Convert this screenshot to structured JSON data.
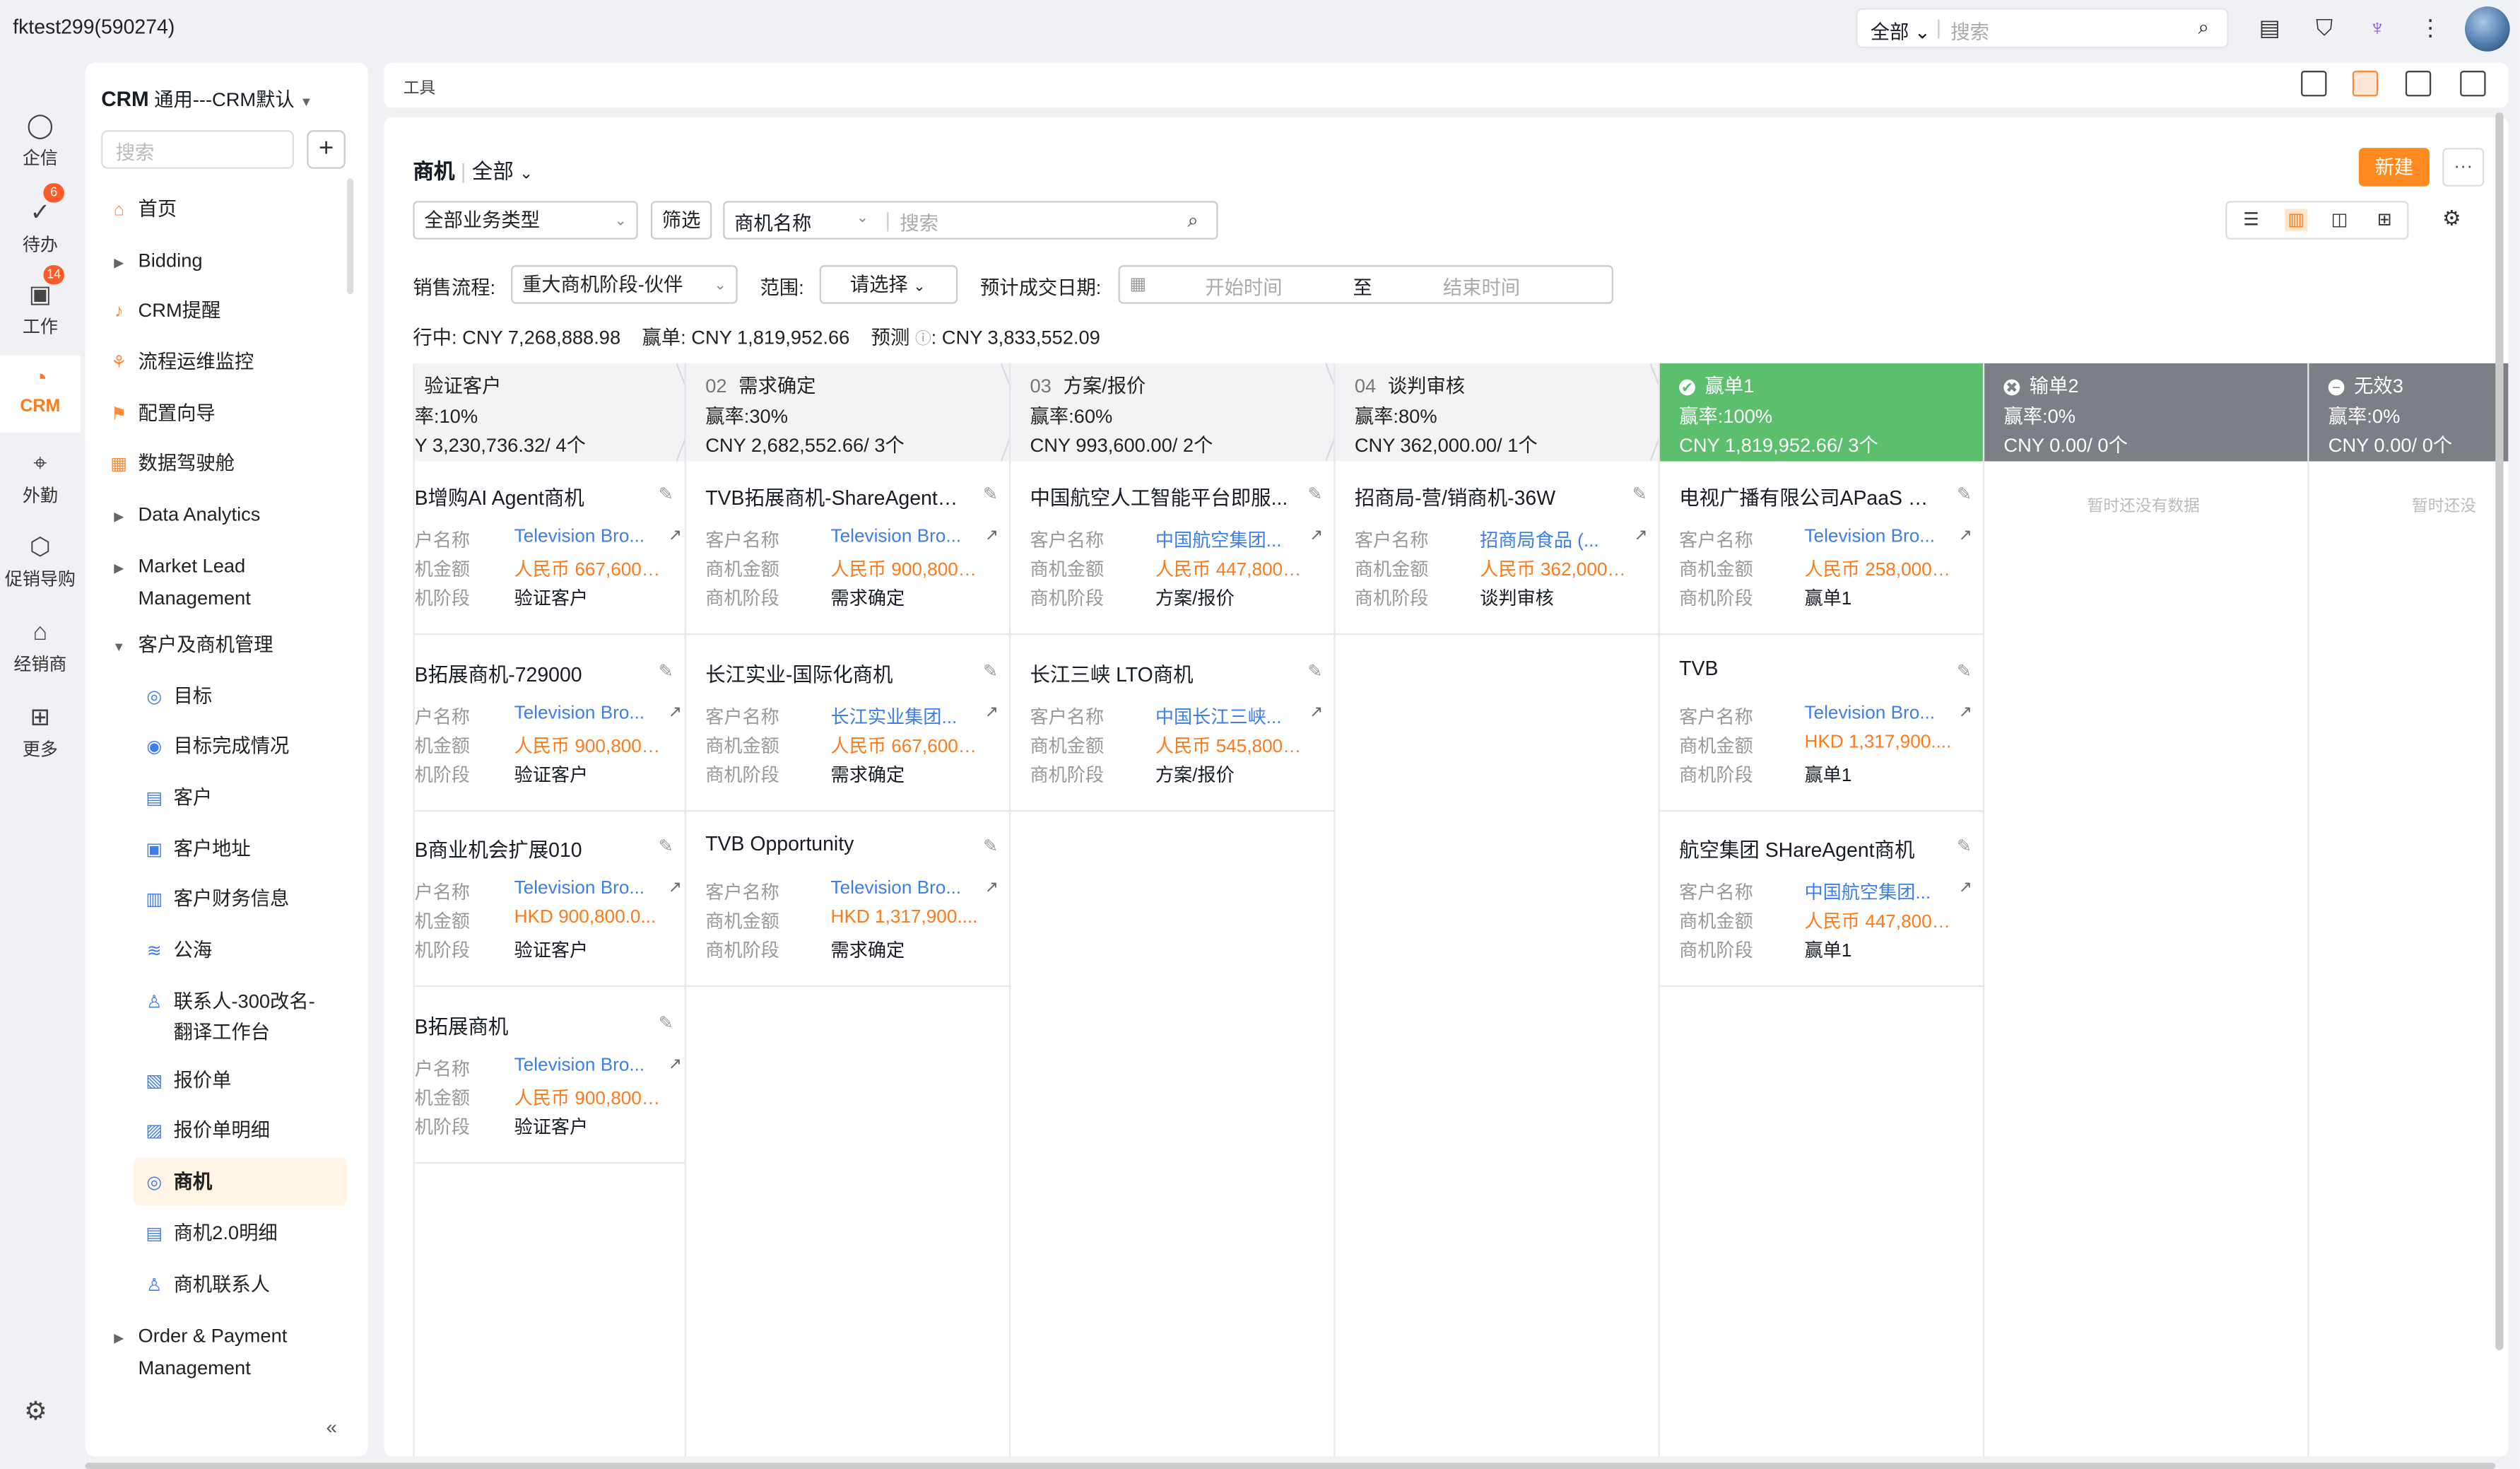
{
  "account": "fktest299(590274)",
  "global_search": {
    "scope": "全部",
    "placeholder": "搜索"
  },
  "left_nav": [
    {
      "label": "企信",
      "icon": "chat-icon",
      "badge": ""
    },
    {
      "label": "待办",
      "icon": "todo-icon",
      "badge": "6"
    },
    {
      "label": "工作",
      "icon": "work-icon",
      "badge": "14"
    },
    {
      "label": "CRM",
      "icon": "crm-icon",
      "badge": "",
      "active": true
    },
    {
      "label": "外勤",
      "icon": "location-icon",
      "badge": ""
    },
    {
      "label": "促销导购",
      "icon": "promotion-icon",
      "badge": ""
    },
    {
      "label": "经销商",
      "icon": "dealer-icon",
      "badge": ""
    },
    {
      "label": "更多",
      "icon": "grid-icon",
      "badge": ""
    }
  ],
  "sidebar": {
    "title_bold": "CRM",
    "title_rest": "通用---CRM默认",
    "search_placeholder": "搜索",
    "items": [
      {
        "label": "首页",
        "icon": "home-icon"
      },
      {
        "label": "Bidding",
        "icon": "expand-icon"
      },
      {
        "label": "CRM提醒",
        "icon": "bell-icon"
      },
      {
        "label": "流程运维监控",
        "icon": "flow-icon"
      },
      {
        "label": "配置向导",
        "icon": "flag-icon"
      },
      {
        "label": "数据驾驶舱",
        "icon": "dashboard-icon"
      },
      {
        "label": "Data Analytics",
        "icon": "expand-icon"
      },
      {
        "label": "Market Lead",
        "label2": "Management",
        "icon": "expand-icon"
      },
      {
        "label": "客户及商机管理",
        "icon": "collapse-icon"
      },
      {
        "label": "目标",
        "icon": "target-icon"
      },
      {
        "label": "目标完成情况",
        "icon": "check-circle-icon"
      },
      {
        "label": "客户",
        "icon": "customer-icon"
      },
      {
        "label": "客户地址",
        "icon": "address-icon"
      },
      {
        "label": "客户财务信息",
        "icon": "finance-icon"
      },
      {
        "label": "公海",
        "icon": "sea-icon"
      },
      {
        "label": "联系人-300改名-",
        "label2": "翻译工作台",
        "icon": "contact-icon"
      },
      {
        "label": "报价单",
        "icon": "quote-icon"
      },
      {
        "label": "报价单明细",
        "icon": "quote-detail-icon"
      },
      {
        "label": "商机",
        "icon": "opportunity-icon"
      },
      {
        "label": "商机2.0明细",
        "icon": "opportunity-detail-icon"
      },
      {
        "label": "商机联系人",
        "icon": "opportunity-contact-icon"
      },
      {
        "label": "Order & Payment",
        "label2": "Management",
        "icon": "expand-icon"
      }
    ]
  },
  "toolbar": {
    "label": "工具"
  },
  "main": {
    "object_name": "商机",
    "scope": "全部",
    "new_button": "新建",
    "more_button": "···",
    "business_type": "全部业务类型",
    "filter_button": "筛选",
    "search_field": "商机名称",
    "search_placeholder": "搜索",
    "sales_process_label": "销售流程:",
    "sales_process_value": "重大商机阶段-伙伴",
    "range_label": "范围:",
    "range_value": "请选择",
    "close_date_label": "预计成交日期:",
    "date_start_placeholder": "开始时间",
    "date_to": "至",
    "date_end_placeholder": "结束时间",
    "summary": {
      "in_progress_label": "行中:",
      "in_progress_value": "CNY 7,268,888.98",
      "won_label": "赢单:",
      "won_value": "CNY 1,819,952.66",
      "forecast_label": "预测",
      "forecast_value": ": CNY 3,833,552.09"
    }
  },
  "field_labels": {
    "customer": "客户名称",
    "amount": "商机金额",
    "stage": "商机阶段"
  },
  "stages": [
    {
      "num": "",
      "name": "验证客户",
      "rate": "率:10%",
      "total": "Y 3,230,736.32/ 4个",
      "style": "normal",
      "cards": [
        {
          "title": "B增购AI Agent商机",
          "k1": "户名称",
          "k2": "机金额",
          "k3": "机阶段",
          "customer": "Television Bro...",
          "amount": "人民币 667,600....",
          "stage": "验证客户"
        },
        {
          "title": "B拓展商机-729000",
          "k1": "户名称",
          "k2": "机金额",
          "k3": "机阶段",
          "customer": "Television Bro...",
          "amount": "人民币 900,800....",
          "stage": "验证客户"
        },
        {
          "title": "B商业机会扩展010",
          "k1": "户名称",
          "k2": "机金额",
          "k3": "机阶段",
          "customer": "Television Bro...",
          "amount": "HKD 900,800.0...",
          "stage": "验证客户"
        },
        {
          "title": "B拓展商机",
          "k1": "户名称",
          "k2": "机金额",
          "k3": "机阶段",
          "customer": "Television Bro...",
          "amount": "人民币 900,800....",
          "stage": "验证客户"
        }
      ]
    },
    {
      "num": "02",
      "name": "需求确定",
      "rate": "赢率:30%",
      "total": "CNY 2,682,552.66/ 3个",
      "style": "normal",
      "cards": [
        {
          "title": "TVB拓展商机-ShareAgent&I...",
          "customer": "Television Bro...",
          "amount": "人民币 900,800....",
          "stage": "需求确定"
        },
        {
          "title": "长江实业-国际化商机",
          "customer": "长江实业集团...",
          "amount": "人民币 667,600....",
          "stage": "需求确定"
        },
        {
          "title": "TVB Opportunity",
          "customer": "Television Bro...",
          "amount": "HKD 1,317,900....",
          "stage": "需求确定"
        }
      ]
    },
    {
      "num": "03",
      "name": "方案/报价",
      "rate": "赢率:60%",
      "total": "CNY 993,600.00/ 2个",
      "style": "normal",
      "cards": [
        {
          "title": "中国航空人工智能平台即服...",
          "customer": "中国航空集团...",
          "amount": "人民币 447,800....",
          "stage": "方案/报价"
        },
        {
          "title": "长江三峡 LTO商机",
          "customer": "中国长江三峡...",
          "amount": "人民币 545,800....",
          "stage": "方案/报价"
        }
      ]
    },
    {
      "num": "04",
      "name": "谈判审核",
      "rate": "赢率:80%",
      "total": "CNY 362,000.00/ 1个",
      "style": "normal",
      "cards": [
        {
          "title": "招商局-营/销商机-36W",
          "customer": "招商局食品 (...",
          "amount": "人民币 362,000....",
          "stage": "谈判审核"
        }
      ]
    },
    {
      "num": "",
      "name": "赢单1",
      "rate": "赢率:100%",
      "total": "CNY 1,819,952.66/ 3个",
      "style": "won",
      "mark": "✔",
      "cards": [
        {
          "title": "电视广播有限公司APaaS 商机",
          "customer": "Television Bro...",
          "amount": "人民币 258,000....",
          "stage": "赢单1"
        },
        {
          "title": "TVB",
          "customer": "Television Bro...",
          "amount": "HKD 1,317,900....",
          "stage": "赢单1"
        },
        {
          "title": "航空集团 SHareAgent商机",
          "customer": "中国航空集团...",
          "amount": "人民币 447,800....",
          "stage": "赢单1"
        }
      ]
    },
    {
      "num": "",
      "name": "输单2",
      "rate": "赢率:0%",
      "total": "CNY 0.00/ 0个",
      "style": "lost",
      "mark": "✖",
      "empty": "暂时还没有数据",
      "cards": []
    },
    {
      "num": "",
      "name": "无效3",
      "rate": "赢率:0%",
      "total": "CNY 0.00/ 0个",
      "style": "lost",
      "mark": "−",
      "empty": "暂时还没",
      "cards": []
    }
  ],
  "colors": {
    "accent": "#ff8a1f",
    "won": "#5cbf6e",
    "lost": "#7c7f86",
    "link": "#3d7ee8",
    "money": "#ff7a1a"
  }
}
